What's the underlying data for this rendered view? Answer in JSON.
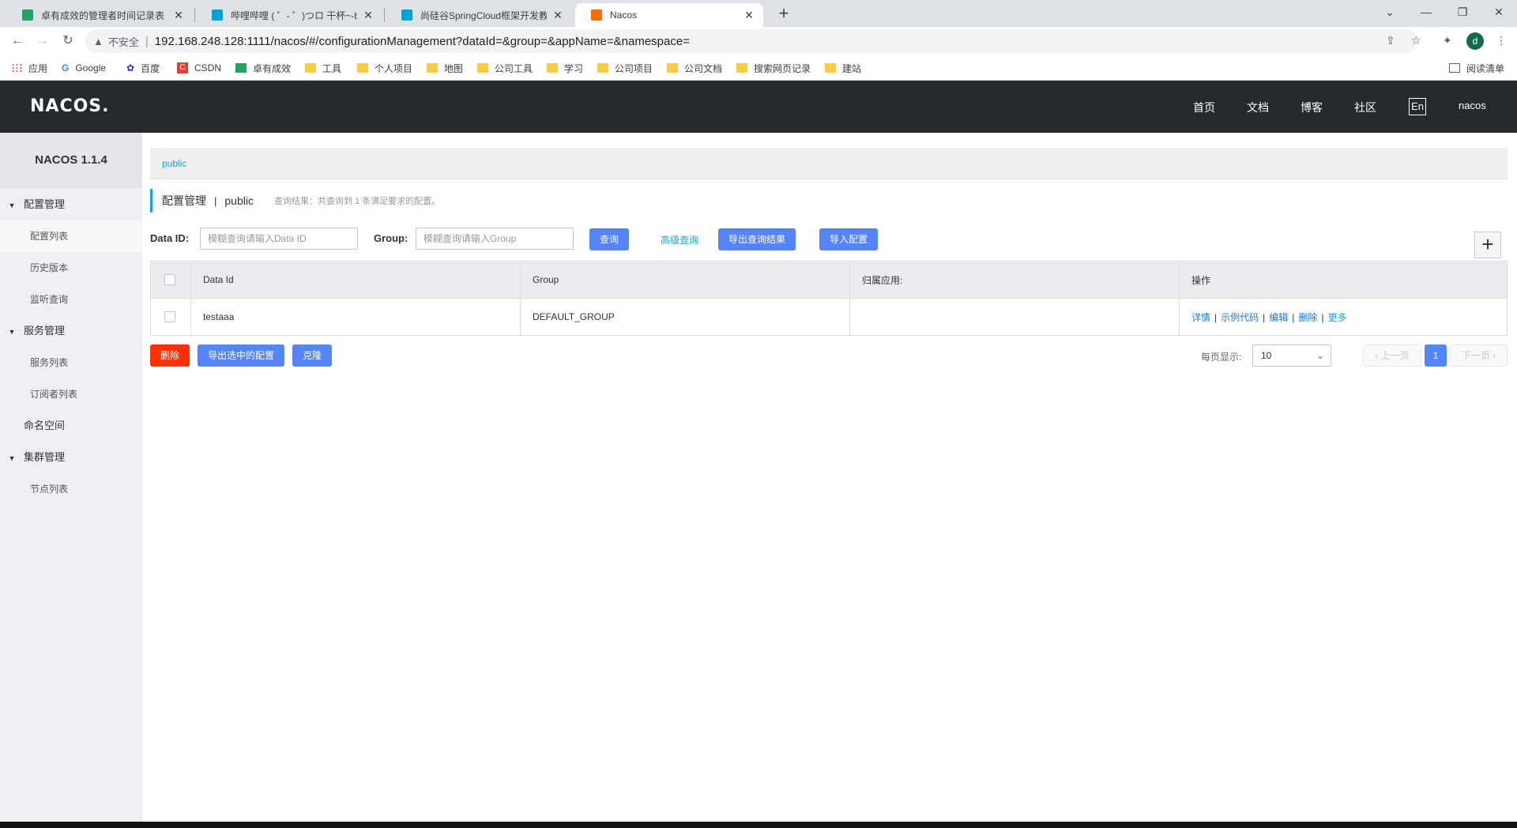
{
  "browser": {
    "tabs": [
      {
        "title": "卓有成效的管理者时间记录表 - 金",
        "favicon_color": "#21a366"
      },
      {
        "title": "哔哩哔哩 ( ゜- ゜)つロ 干杯~-bili",
        "favicon_color": "#00a1d6"
      },
      {
        "title": "尚硅谷SpringCloud框架开发教程",
        "favicon_color": "#00a1d6"
      },
      {
        "title": "Nacos",
        "favicon_color": "#ff6a00"
      }
    ],
    "new_tab_icon": "plus-icon",
    "address": {
      "insecure_label": "不安全",
      "url": "192.168.248.128:1111/nacos/#/configurationManagement?dataId=&group=&appName=&namespace="
    },
    "profile_initial": "d",
    "bookmarks": [
      {
        "label": "应用",
        "icon": "apps-icon"
      },
      {
        "label": "Google",
        "icon": "google-icon"
      },
      {
        "label": "百度",
        "icon": "baidu-icon"
      },
      {
        "label": "CSDN",
        "icon": "csdn-icon"
      },
      {
        "label": "卓有成效",
        "icon": "sheet-icon"
      },
      {
        "label": "工具",
        "icon": "folder-icon"
      },
      {
        "label": "个人项目",
        "icon": "folder-icon"
      },
      {
        "label": "地图",
        "icon": "folder-icon"
      },
      {
        "label": "公司工具",
        "icon": "folder-icon"
      },
      {
        "label": "学习",
        "icon": "folder-icon"
      },
      {
        "label": "公司项目",
        "icon": "folder-icon"
      },
      {
        "label": "公司文档",
        "icon": "folder-icon"
      },
      {
        "label": "搜索网页记录",
        "icon": "folder-icon"
      },
      {
        "label": "建站",
        "icon": "folder-icon"
      }
    ],
    "reading_list": "阅读清单"
  },
  "header": {
    "logo": "NACOS.",
    "nav": [
      "首页",
      "文档",
      "博客",
      "社区"
    ],
    "lang": "En",
    "user": "nacos"
  },
  "sidebar": {
    "version": "NACOS 1.1.4",
    "groups": [
      {
        "label": "配置管理",
        "items": [
          "配置列表",
          "历史版本",
          "监听查询"
        ]
      },
      {
        "label": "服务管理",
        "items": [
          "服务列表",
          "订阅者列表"
        ]
      },
      {
        "label": "命名空间"
      },
      {
        "label": "集群管理",
        "items": [
          "节点列表"
        ]
      }
    ]
  },
  "main": {
    "namespace_tab": "public",
    "title": "配置管理",
    "title_sep": "|",
    "title_namespace": "public",
    "query_result": "查询结果：共查询到 1 条满足要求的配置。",
    "search": {
      "dataid_label": "Data ID:",
      "dataid_placeholder": "模糊查询请输入Data ID",
      "group_label": "Group:",
      "group_placeholder": "模糊查询请输入Group",
      "query_button": "查询",
      "advanced_link": "高级查询",
      "export_result_button": "导出查询结果",
      "import_button": "导入配置"
    },
    "table": {
      "columns": [
        "Data Id",
        "Group",
        "归属应用:",
        "操作"
      ],
      "rows": [
        {
          "data_id": "testaaa",
          "group": "DEFAULT_GROUP",
          "app": "",
          "actions": [
            "详情",
            "示例代码",
            "编辑",
            "删除",
            "更多"
          ]
        }
      ]
    },
    "bulk": {
      "delete_button": "删除",
      "export_selected_button": "导出选中的配置",
      "clone_button": "克隆"
    },
    "pagination": {
      "page_size_label": "每页显示:",
      "page_size": "10",
      "prev": "上一页",
      "current_page": "1",
      "next": "下一页"
    }
  },
  "colors": {
    "primary": "#5584ff",
    "danger": "#ff3000",
    "link": "#1ba0e1",
    "header_bg": "#252a2f"
  }
}
